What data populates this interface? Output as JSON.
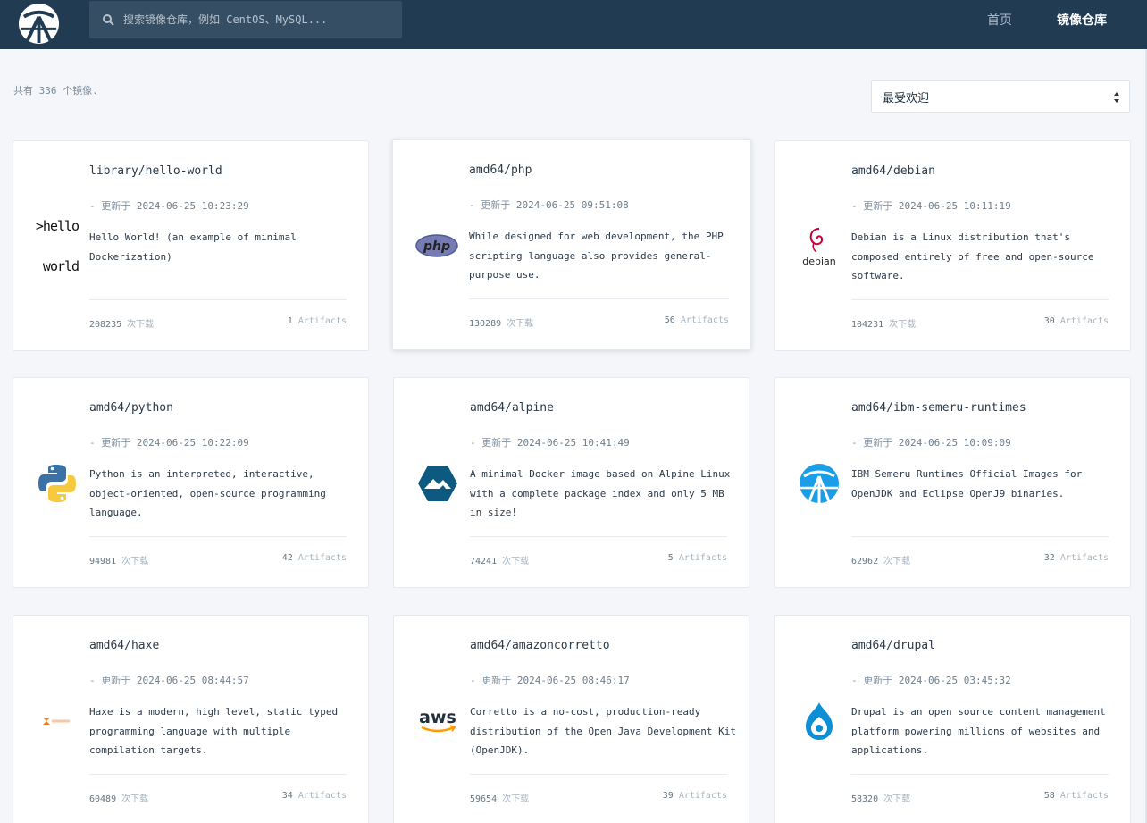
{
  "search": {
    "placeholder": "搜索镜像仓库，例如 CentOS、MySQL..."
  },
  "nav": {
    "home": "首页",
    "repo": "镜像仓库"
  },
  "summary": "共有 336 个镜像.",
  "sort": {
    "selected": "最受欢迎"
  },
  "labels": {
    "updated_prefix": "- 更新于",
    "downloads_suffix": "次下载",
    "artifacts_suffix": "Artifacts"
  },
  "colors": {
    "navbar": "#213b53",
    "search_bg": "#364e64",
    "page_bg": "#f4f6fa"
  },
  "cards": [
    {
      "name": "library/hello-world",
      "updated": "2024-06-25 10:23:29",
      "description": "Hello World! (an example of minimal Dockerization)",
      "downloads": "208235",
      "artifacts": "1",
      "logo": "hello-world-logo",
      "logo_text": [
        ">hello",
        " world"
      ]
    },
    {
      "name": "amd64/php",
      "updated": "2024-06-25 09:51:08",
      "description": "While designed for web development, the PHP scripting language also provides general-purpose use.",
      "downloads": "130289",
      "artifacts": "56",
      "logo": "php-logo",
      "logo_text": "php"
    },
    {
      "name": "amd64/debian",
      "updated": "2024-06-25 10:11:19",
      "description": "Debian is a Linux distribution that's composed entirely of free and open-source software.",
      "downloads": "104231",
      "artifacts": "30",
      "logo": "debian-logo",
      "logo_text": "debian"
    },
    {
      "name": "amd64/python",
      "updated": "2024-06-25 10:22:09",
      "description": "Python is an interpreted, interactive, object-oriented, open-source programming language.",
      "downloads": "94981",
      "artifacts": "42",
      "logo": "python-logo"
    },
    {
      "name": "amd64/alpine",
      "updated": "2024-06-25 10:41:49",
      "description": "A minimal Docker image based on Alpine Linux with a complete package index and only 5 MB in size!",
      "downloads": "74241",
      "artifacts": "5",
      "logo": "alpine-logo"
    },
    {
      "name": "amd64/ibm-semeru-runtimes",
      "updated": "2024-06-25 10:09:09",
      "description": "IBM Semeru Runtimes Official Images for OpenJDK and Eclipse OpenJ9 binaries.",
      "downloads": "62962",
      "artifacts": "32",
      "logo": "semeru-logo"
    },
    {
      "name": "amd64/haxe",
      "updated": "2024-06-25 08:44:57",
      "description": "Haxe is a modern, high level, static typed programming language with multiple compilation targets.",
      "downloads": "60489",
      "artifacts": "34",
      "logo": "haxe-logo"
    },
    {
      "name": "amd64/amazoncorretto",
      "updated": "2024-06-25 08:46:17",
      "description": "Corretto is a no-cost, production-ready distribution of the Open Java Development Kit (OpenJDK).",
      "downloads": "59654",
      "artifacts": "39",
      "logo": "aws-logo",
      "logo_text": "aws"
    },
    {
      "name": "amd64/drupal",
      "updated": "2024-06-25 03:45:32",
      "description": "Drupal is an open source content management platform powering millions of websites and applications.",
      "downloads": "58320",
      "artifacts": "58",
      "logo": "drupal-logo"
    }
  ]
}
